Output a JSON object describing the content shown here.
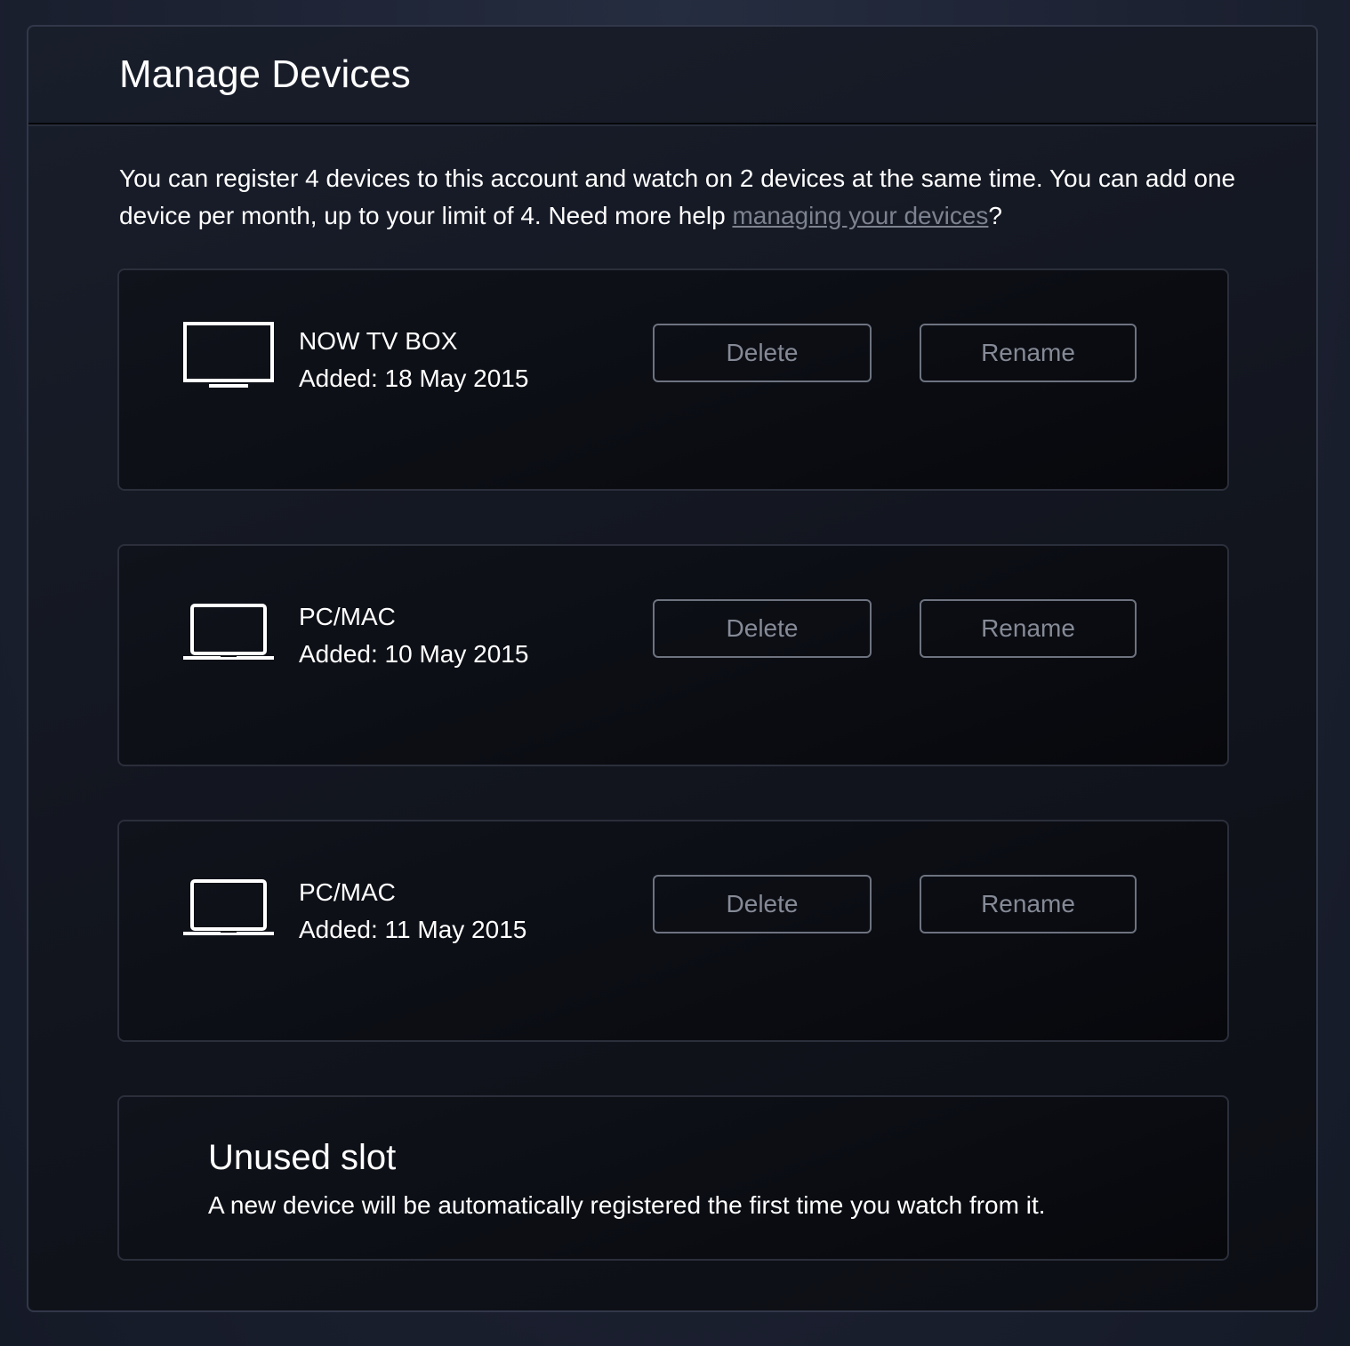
{
  "header": {
    "title": "Manage Devices"
  },
  "intro": {
    "text": "You can register 4 devices to this account and watch on 2 devices at the same time. You can add one device per month, up to your limit of 4. Need more help ",
    "link_label": "managing your devices",
    "suffix": "?"
  },
  "devices": [
    {
      "icon": "tv-icon",
      "name": "NOW TV BOX",
      "added": "Added: 18 May 2015",
      "delete_label": "Delete",
      "rename_label": "Rename"
    },
    {
      "icon": "laptop-icon",
      "name": "PC/MAC",
      "added": "Added: 10 May 2015",
      "delete_label": "Delete",
      "rename_label": "Rename"
    },
    {
      "icon": "laptop-icon",
      "name": "PC/MAC",
      "added": "Added: 11 May 2015",
      "delete_label": "Delete",
      "rename_label": "Rename"
    }
  ],
  "unused_slot": {
    "title": "Unused slot",
    "description": "A new device will be automatically registered the first time you watch from it."
  },
  "colors": {
    "background": "#1e2434",
    "card": "#0b0d13",
    "button_border": "#6e7380",
    "button_text": "#858a96",
    "link": "#7d8290"
  }
}
